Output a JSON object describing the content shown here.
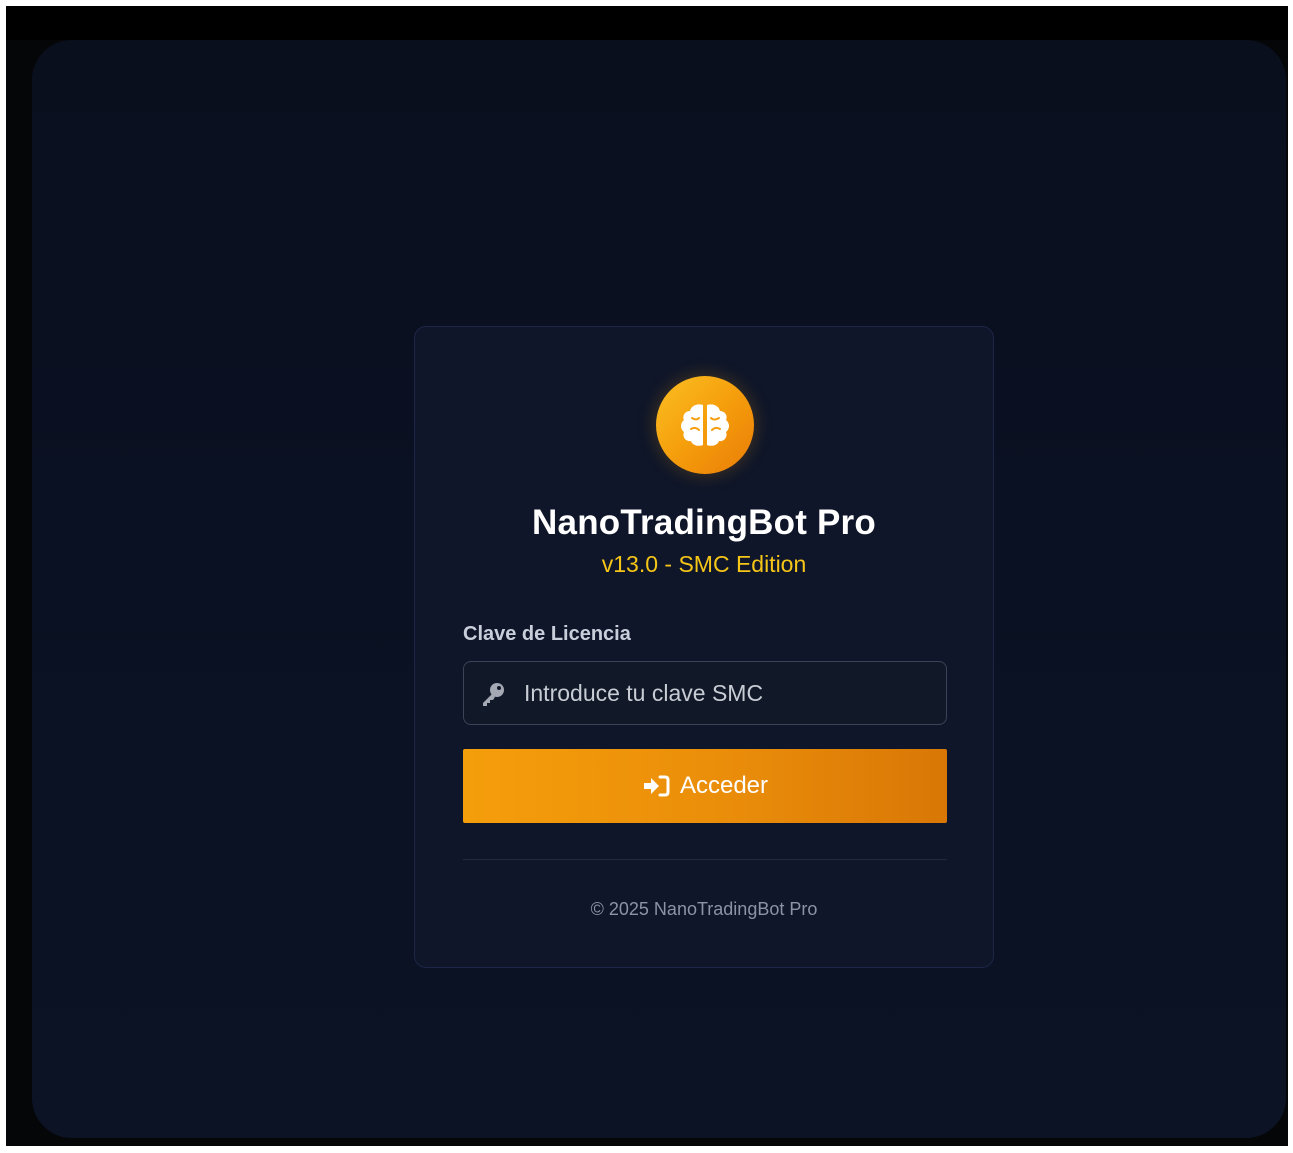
{
  "app": {
    "name": "NanoTradingBot Pro",
    "version": "v13.0 - SMC Edition"
  },
  "login": {
    "logo_icon": "brain-icon",
    "license_label": "Clave de Licencia",
    "license_input": {
      "value": "",
      "placeholder": "Introduce tu clave SMC",
      "icon": "key-icon"
    },
    "submit_label": "Acceder",
    "submit_icon": "sign-in-icon",
    "footer": "© 2025 NanoTradingBot Pro"
  },
  "colors": {
    "background": "#0a1122",
    "card": "#0f1629",
    "accent": "#f59e0b",
    "version_text": "#f5c518"
  }
}
